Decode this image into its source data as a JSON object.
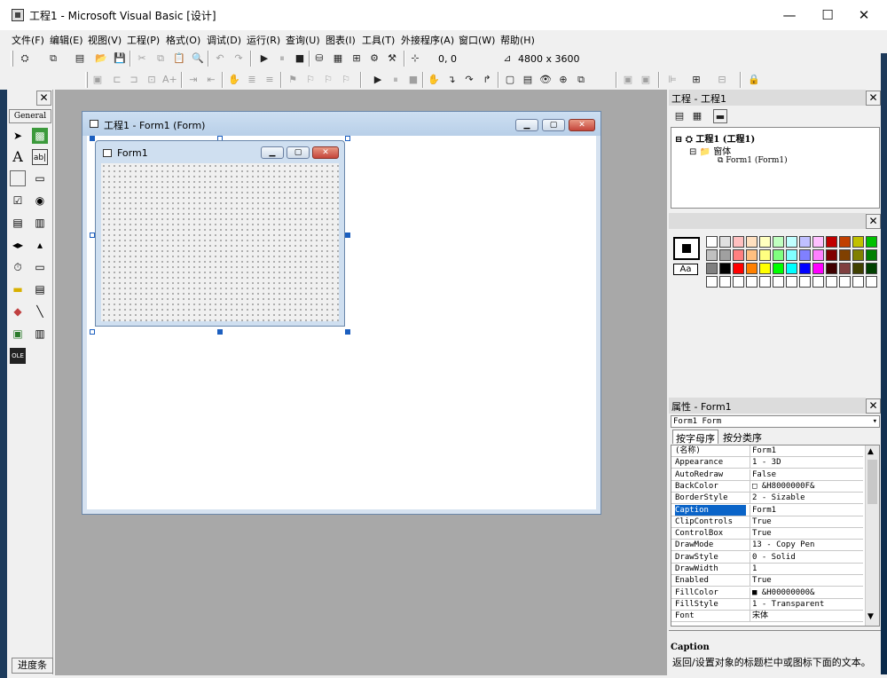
{
  "title": "工程1 - Microsoft Visual Basic [设计]",
  "window_controls": {
    "minimize": "—",
    "maximize": "☐",
    "close": "✕"
  },
  "menu": [
    "文件(F)",
    "编辑(E)",
    "视图(V)",
    "工程(P)",
    "格式(O)",
    "调试(D)",
    "运行(R)",
    "查询(U)",
    "图表(I)",
    "工具(T)",
    "外接程序(A)",
    "窗口(W)",
    "帮助(H)"
  ],
  "toolbar": {
    "position": "0, 0",
    "size": "4800 x 3600"
  },
  "toolbox": {
    "general_label": "General",
    "progress_button": "进度条",
    "close": "✕"
  },
  "mdi_window": {
    "title": "工程1 - Form1 (Form)"
  },
  "form": {
    "title": "Form1"
  },
  "project_panel": {
    "title": "工程 - 工程1",
    "close": "✕",
    "tree": {
      "root": "工程1 (工程1)",
      "folder": "窗体",
      "item": "Form1 (Form1)"
    }
  },
  "color_panel": {
    "close": "✕",
    "font_sample": "Aa",
    "colors": [
      [
        "#ffffff",
        "#e0e0e0",
        "#ffc0c0",
        "#ffe0c0",
        "#ffffc0",
        "#c0ffc0",
        "#c0ffff",
        "#c0c0ff",
        "#ffc0ff",
        "#c00000",
        "#c04000",
        "#c0c000",
        "#00c000"
      ],
      [
        "#c0c0c0",
        "#a0a0a0",
        "#ff8080",
        "#ffc080",
        "#ffff80",
        "#80ff80",
        "#80ffff",
        "#8080ff",
        "#ff80ff",
        "#800000",
        "#804000",
        "#808000",
        "#008000"
      ],
      [
        "#808080",
        "#000000",
        "#ff0000",
        "#ff8000",
        "#ffff00",
        "#00ff00",
        "#00ffff",
        "#0000ff",
        "#ff00ff",
        "#400000",
        "#804040",
        "#404000",
        "#004000"
      ],
      [
        "#ffffff",
        "#ffffff",
        "#ffffff",
        "#ffffff",
        "#ffffff",
        "#ffffff",
        "#ffffff",
        "#ffffff",
        "#ffffff",
        "#ffffff",
        "#ffffff",
        "#ffffff",
        "#ffffff"
      ]
    ]
  },
  "properties_panel": {
    "title": "属性 - Form1",
    "close": "✕",
    "object": "Form1 Form",
    "tabs": [
      "按字母序",
      "按分类序"
    ],
    "rows": [
      {
        "name": "(名称)",
        "value": "Form1"
      },
      {
        "name": "Appearance",
        "value": "1 - 3D"
      },
      {
        "name": "AutoRedraw",
        "value": "False"
      },
      {
        "name": "BackColor",
        "value": "□ &H8000000F&"
      },
      {
        "name": "BorderStyle",
        "value": "2 - Sizable"
      },
      {
        "name": "Caption",
        "value": "Form1"
      },
      {
        "name": "ClipControls",
        "value": "True"
      },
      {
        "name": "ControlBox",
        "value": "True"
      },
      {
        "name": "DrawMode",
        "value": "13 - Copy Pen"
      },
      {
        "name": "DrawStyle",
        "value": "0 - Solid"
      },
      {
        "name": "DrawWidth",
        "value": "1"
      },
      {
        "name": "Enabled",
        "value": "True"
      },
      {
        "name": "FillColor",
        "value": "■ &H00000000&"
      },
      {
        "name": "FillStyle",
        "value": "1 - Transparent"
      },
      {
        "name": "Font",
        "value": "宋体"
      }
    ],
    "desc_title": "Caption",
    "desc_text": "返回/设置对象的标题栏中或图标下面的文本。"
  }
}
